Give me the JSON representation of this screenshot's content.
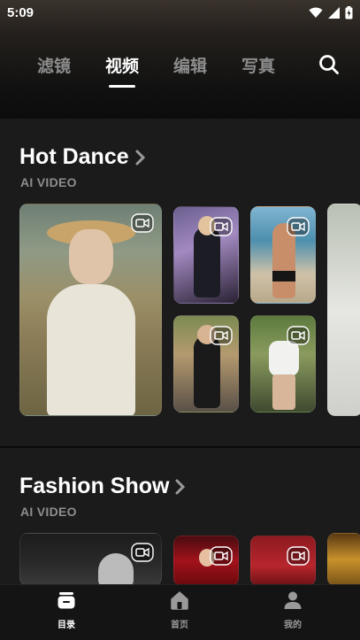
{
  "status_bar": {
    "time": "5:09"
  },
  "top_tabs": [
    {
      "label": "滤镜",
      "active": false
    },
    {
      "label": "视频",
      "active": true
    },
    {
      "label": "编辑",
      "active": false
    },
    {
      "label": "写真",
      "active": false
    }
  ],
  "sections": [
    {
      "title": "Hot Dance",
      "subtitle": "AI VIDEO"
    },
    {
      "title": "Fashion Show",
      "subtitle": "AI VIDEO"
    }
  ],
  "bottom_nav": [
    {
      "label": "目录",
      "icon": "catalog-icon",
      "active": true
    },
    {
      "label": "首页",
      "icon": "home-icon",
      "active": false
    },
    {
      "label": "我的",
      "icon": "profile-icon",
      "active": false
    }
  ],
  "colors": {
    "active_text": "#ffffff",
    "inactive_text": "#8c8c8c",
    "section_bg": "#1b1b1b",
    "page_bg": "#0a0a0a"
  }
}
